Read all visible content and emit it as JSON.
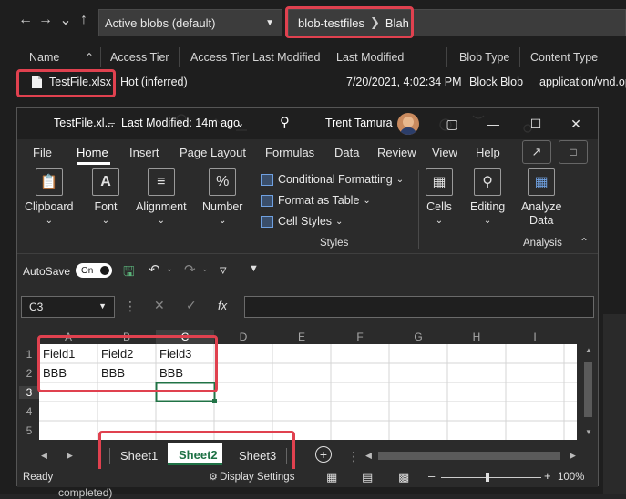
{
  "explorer": {
    "tier_dropdown": "Active blobs (default)",
    "breadcrumb": [
      "blob-testfiles",
      "Blah"
    ],
    "columns": [
      "Name",
      "Access Tier",
      "Access Tier Last Modified",
      "Last Modified",
      "Blob Type",
      "Content Type"
    ],
    "row": {
      "name": "TestFile.xlsx",
      "access_tier": "Hot (inferred)",
      "last_modified": "7/20/2021, 4:02:34 PM",
      "blob_type": "Block Blob",
      "content_type": "application/vnd.op"
    },
    "bottom_text": "completed)"
  },
  "excel": {
    "title": "TestFile.xl...",
    "last_modified": "Last Modified: 14m ago",
    "user": "Trent Tamura",
    "tabs": [
      "File",
      "Home",
      "Insert",
      "Page Layout",
      "Formulas",
      "Data",
      "Review",
      "View",
      "Help"
    ],
    "ribbon": {
      "clipboard": "Clipboard",
      "font": "Font",
      "alignment": "Alignment",
      "number": "Number",
      "cond_format": "Conditional Formatting",
      "format_table": "Format as Table",
      "cell_styles": "Cell Styles",
      "styles_group": "Styles",
      "cells": "Cells",
      "editing": "Editing",
      "analyze_1": "Analyze",
      "analyze_2": "Data",
      "analysis_group": "Analysis"
    },
    "qat": {
      "autosave": "AutoSave",
      "toggle": "On"
    },
    "namebox": "C3",
    "fx": "fx",
    "col_headers": [
      "A",
      "B",
      "C",
      "D",
      "E",
      "F",
      "G",
      "H",
      "I"
    ],
    "row_headers": [
      "1",
      "2",
      "3",
      "4",
      "5"
    ],
    "cells": {
      "A1": "Field1",
      "B1": "Field2",
      "C1": "Field3",
      "A2": "BBB",
      "B2": "BBB",
      "C2": "BBB"
    },
    "sheets": [
      "Sheet1",
      "Sheet2",
      "Sheet3"
    ],
    "active_sheet": "Sheet2",
    "status": {
      "ready": "Ready",
      "display": "Display Settings",
      "zoom": "100%"
    }
  },
  "colors": {
    "highlight": "#e0414f",
    "excel_green": "#1e7145",
    "selection": "#217346"
  }
}
